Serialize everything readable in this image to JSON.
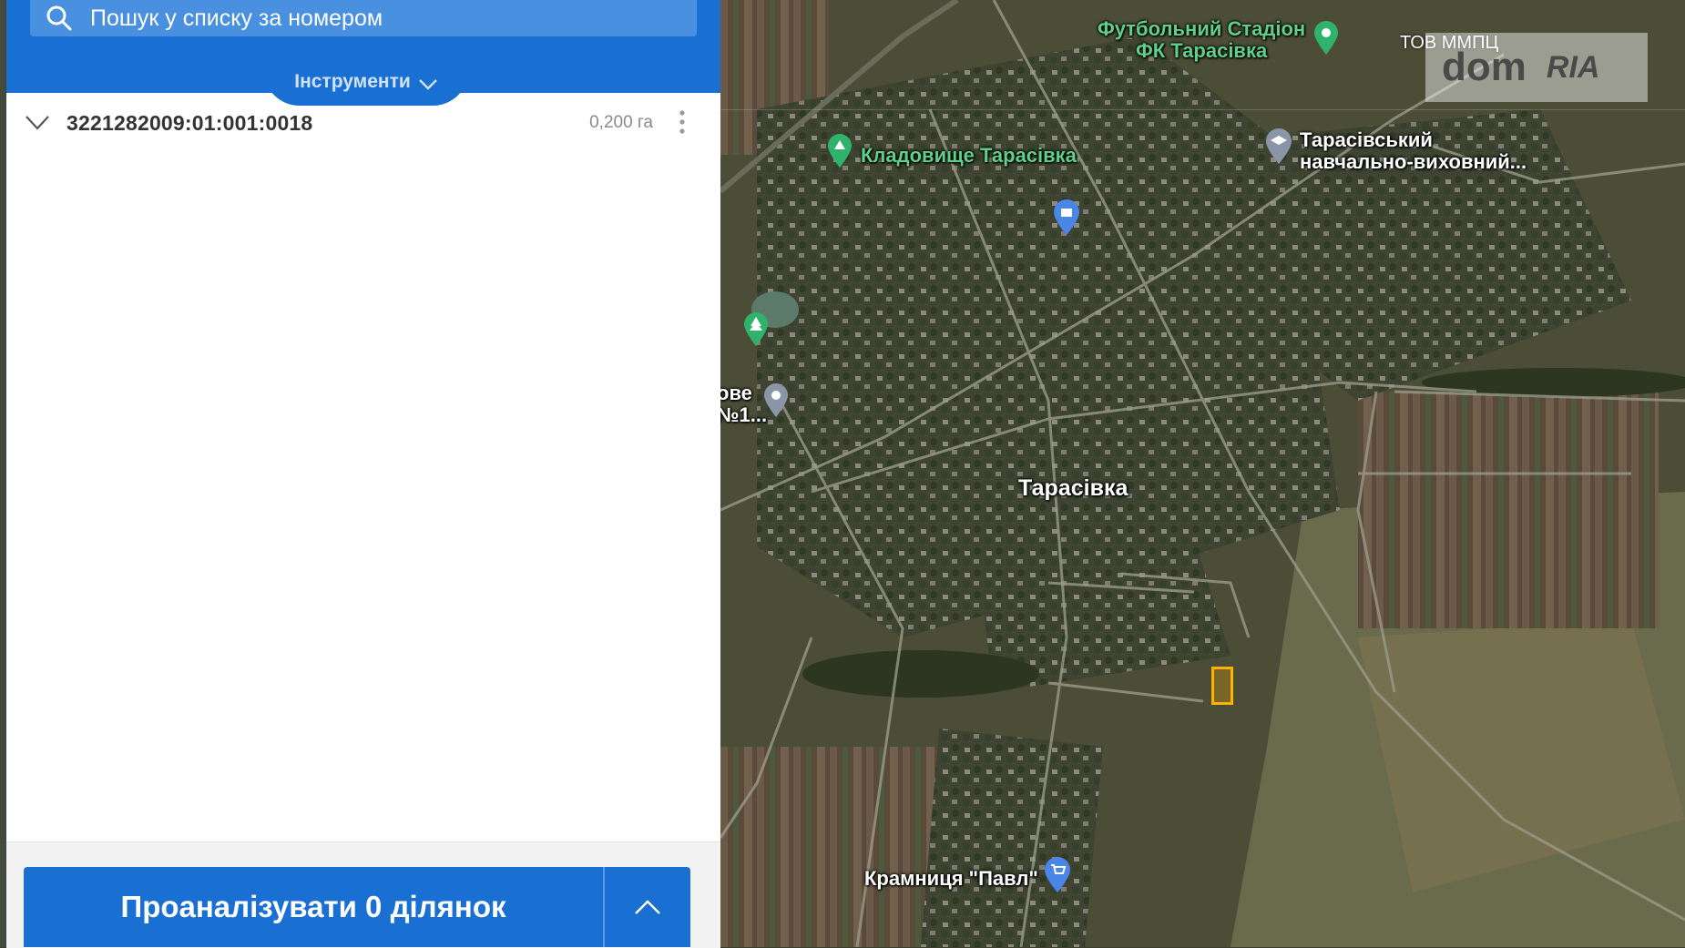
{
  "search": {
    "placeholder": "Пошук у списку за номером",
    "icon": "search-icon"
  },
  "tools": {
    "label": "Інструменти",
    "icon": "chevron-down-icon"
  },
  "parcels": [
    {
      "number": "3221282009:01:001:0018",
      "area": "0,200 га",
      "highlight_color": "#ffb300"
    }
  ],
  "footer": {
    "analyze_label": "Проаналізувати 0 ділянок",
    "expand_icon": "chevron-up-icon"
  },
  "map": {
    "labels": {
      "stadium": "Футбольний Стадіон\nФК Тарасівка",
      "cemetery": "Кладовище Тарасівка",
      "school": "Тарасівський\nнавчально-виховний...",
      "village": "Тарасівка",
      "shop": "Крамниця \"Павл\"",
      "partial_left": "ове\n№1...",
      "tov": "ТОВ ММПЦ"
    },
    "watermark": {
      "dom": "dom",
      "ria": "RIA"
    }
  },
  "colors": {
    "primary": "#1a6fd3",
    "search_bg": "#4a90e0",
    "parcel_outline": "#ffb300"
  }
}
